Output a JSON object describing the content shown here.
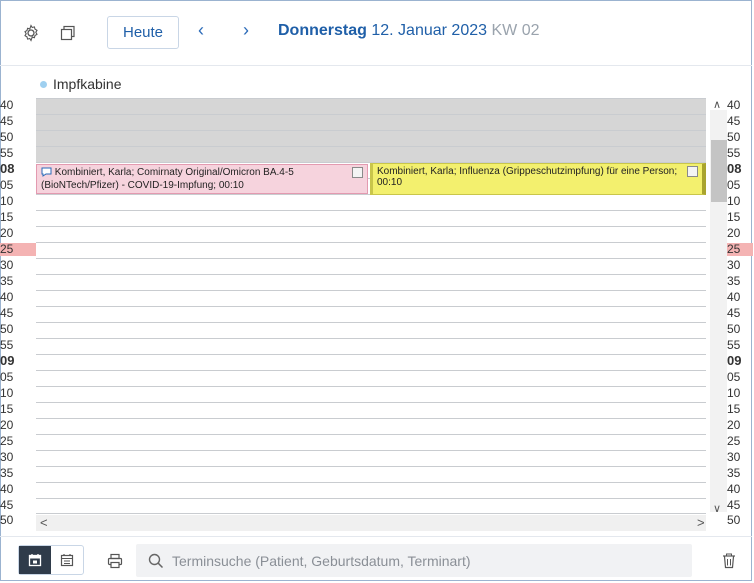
{
  "toolbar": {
    "settings_icon": "gear-icon",
    "copy_icon": "copy-icon",
    "today_label": "Heute",
    "prev_icon": "chevron-left-icon",
    "next_icon": "chevron-right-icon",
    "weekday": "Donnerstag",
    "date": "12. Januar 2023",
    "week": "KW 02"
  },
  "resource": {
    "name": "Impfkabine",
    "dot_color": "#9fd0f0"
  },
  "time_labels": [
    {
      "text": "40",
      "bold": false,
      "red": false
    },
    {
      "text": "45",
      "bold": false,
      "red": false
    },
    {
      "text": "50",
      "bold": false,
      "red": false
    },
    {
      "text": "55",
      "bold": false,
      "red": false
    },
    {
      "text": "08",
      "bold": true,
      "red": false
    },
    {
      "text": "05",
      "bold": false,
      "red": false
    },
    {
      "text": "10",
      "bold": false,
      "red": false
    },
    {
      "text": "15",
      "bold": false,
      "red": false
    },
    {
      "text": "20",
      "bold": false,
      "red": false
    },
    {
      "text": "25",
      "bold": false,
      "red": true
    },
    {
      "text": "30",
      "bold": false,
      "red": false
    },
    {
      "text": "35",
      "bold": false,
      "red": false
    },
    {
      "text": "40",
      "bold": false,
      "red": false
    },
    {
      "text": "45",
      "bold": false,
      "red": false
    },
    {
      "text": "50",
      "bold": false,
      "red": false
    },
    {
      "text": "55",
      "bold": false,
      "red": false
    },
    {
      "text": "09",
      "bold": true,
      "red": false
    },
    {
      "text": "05",
      "bold": false,
      "red": false
    },
    {
      "text": "10",
      "bold": false,
      "red": false
    },
    {
      "text": "15",
      "bold": false,
      "red": false
    },
    {
      "text": "20",
      "bold": false,
      "red": false
    },
    {
      "text": "25",
      "bold": false,
      "red": false
    },
    {
      "text": "30",
      "bold": false,
      "red": false
    },
    {
      "text": "35",
      "bold": false,
      "red": false
    },
    {
      "text": "40",
      "bold": false,
      "red": false
    },
    {
      "text": "45",
      "bold": false,
      "red": false
    },
    {
      "text": "50",
      "bold": false,
      "red": false
    }
  ],
  "appointments": [
    {
      "text": "Kombiniert, Karla; Comirnaty Original/Omicron BA.4-5 (BioNTech/Pfizer) - COVID-19-Impfung; 00:10",
      "color": "#f6d3dd",
      "comment_icon": "speech-bubble-icon"
    },
    {
      "text": "Kombiniert, Karla; Influenza (Grippeschutzimpfung) für eine Person; 00:10",
      "color": "#f3f06e"
    }
  ],
  "footer": {
    "day_view_icon": "calendar-day-icon",
    "week_view_icon": "calendar-week-icon",
    "print_icon": "printer-icon",
    "search_icon": "search-icon",
    "search_placeholder": "Terminsuche (Patient, Geburtsdatum, Terminart)",
    "trash_icon": "trash-icon"
  },
  "colors": {
    "accent": "#1f5fa8",
    "current_time": "#f4b3b3",
    "blocked": "#d6d6d6"
  }
}
